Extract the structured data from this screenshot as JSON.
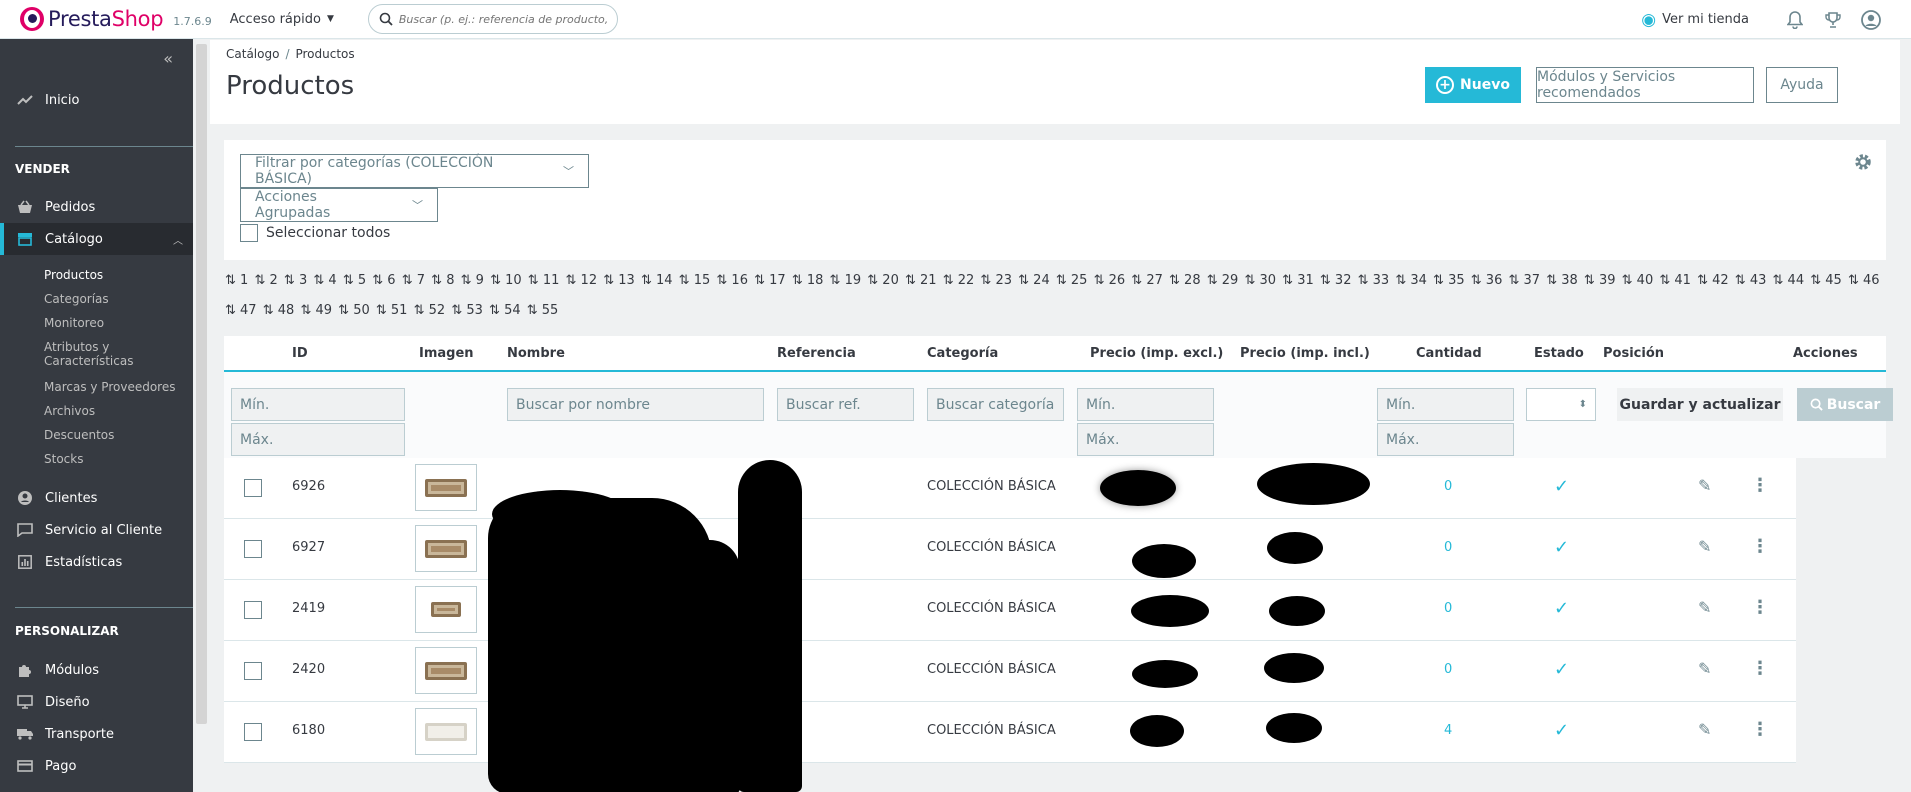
{
  "header": {
    "brand_1": "Presta",
    "brand_2": "Shop",
    "version": "1.7.6.9",
    "quick_access": "Acceso rápido",
    "search_placeholder": "Buscar (p. ej.: referencia de producto, no",
    "view_store": "Ver mi tienda"
  },
  "sidebar": {
    "home": "Inicio",
    "section_sell": "VENDER",
    "orders": "Pedidos",
    "catalog": "Catálogo",
    "catalog_sub": [
      "Productos",
      "Categorías",
      "Monitoreo",
      "Atributos y",
      "Características",
      "Marcas y Proveedores",
      "Archivos",
      "Descuentos",
      "Stocks"
    ],
    "customers": "Clientes",
    "customer_service": "Servicio al Cliente",
    "stats": "Estadísticas",
    "section_customize": "PERSONALIZAR",
    "modules": "Módulos",
    "design": "Diseño",
    "shipping": "Transporte",
    "payment": "Pago"
  },
  "page": {
    "breadcrumb_1": "Catálogo",
    "breadcrumb_sep": "/",
    "breadcrumb_2": "Productos",
    "title": "Productos",
    "btn_new": "Nuevo",
    "btn_modules": "Módulos y Servicios recomendados",
    "btn_help": "Ayuda"
  },
  "filters": {
    "category_filter": "Filtrar por categorías (COLECCIÓN BÁSICA)",
    "bulk_actions": "Acciones Agrupadas",
    "select_all": "Seleccionar todos"
  },
  "sort_links": [
    "1",
    "2",
    "3",
    "4",
    "5",
    "6",
    "7",
    "8",
    "9",
    "10",
    "11",
    "12",
    "13",
    "14",
    "15",
    "16",
    "17",
    "18",
    "19",
    "20",
    "21",
    "22",
    "23",
    "24",
    "25",
    "26",
    "27",
    "28",
    "29",
    "30",
    "31",
    "32",
    "33",
    "34",
    "35",
    "36",
    "37",
    "38",
    "39",
    "40",
    "41",
    "42",
    "43",
    "44",
    "45",
    "46",
    "47",
    "48",
    "49",
    "50",
    "51",
    "52",
    "53",
    "54",
    "55"
  ],
  "table": {
    "headers": {
      "id": "ID",
      "image": "Imagen",
      "name": "Nombre",
      "reference": "Referencia",
      "category": "Categoría",
      "price_excl": "Precio (imp. excl.)",
      "price_incl": "Precio (imp. incl.)",
      "quantity": "Cantidad",
      "status": "Estado",
      "position": "Posición",
      "actions": "Acciones"
    },
    "filter_min": "Mín.",
    "filter_max": "Máx.",
    "search_name": "Buscar por nombre",
    "search_ref": "Buscar ref.",
    "search_category": "Buscar categoría",
    "btn_save": "Guardar y actualizar",
    "btn_search": "Buscar",
    "rows": [
      {
        "id": "6926",
        "category": "COLECCIÓN BÁSICA",
        "quantity": "0"
      },
      {
        "id": "6927",
        "category": "COLECCIÓN BÁSICA",
        "quantity": "0"
      },
      {
        "id": "2419",
        "category": "COLECCIÓN BÁSICA",
        "quantity": "0"
      },
      {
        "id": "2420",
        "category": "COLECCIÓN BÁSICA",
        "quantity": "0"
      },
      {
        "id": "6180",
        "category": "COLECCIÓN BÁSICA",
        "quantity": "4"
      }
    ]
  },
  "colors": {
    "accent": "#25b9d7",
    "sidebar_bg": "#363a41",
    "brand_pink": "#df0067"
  }
}
